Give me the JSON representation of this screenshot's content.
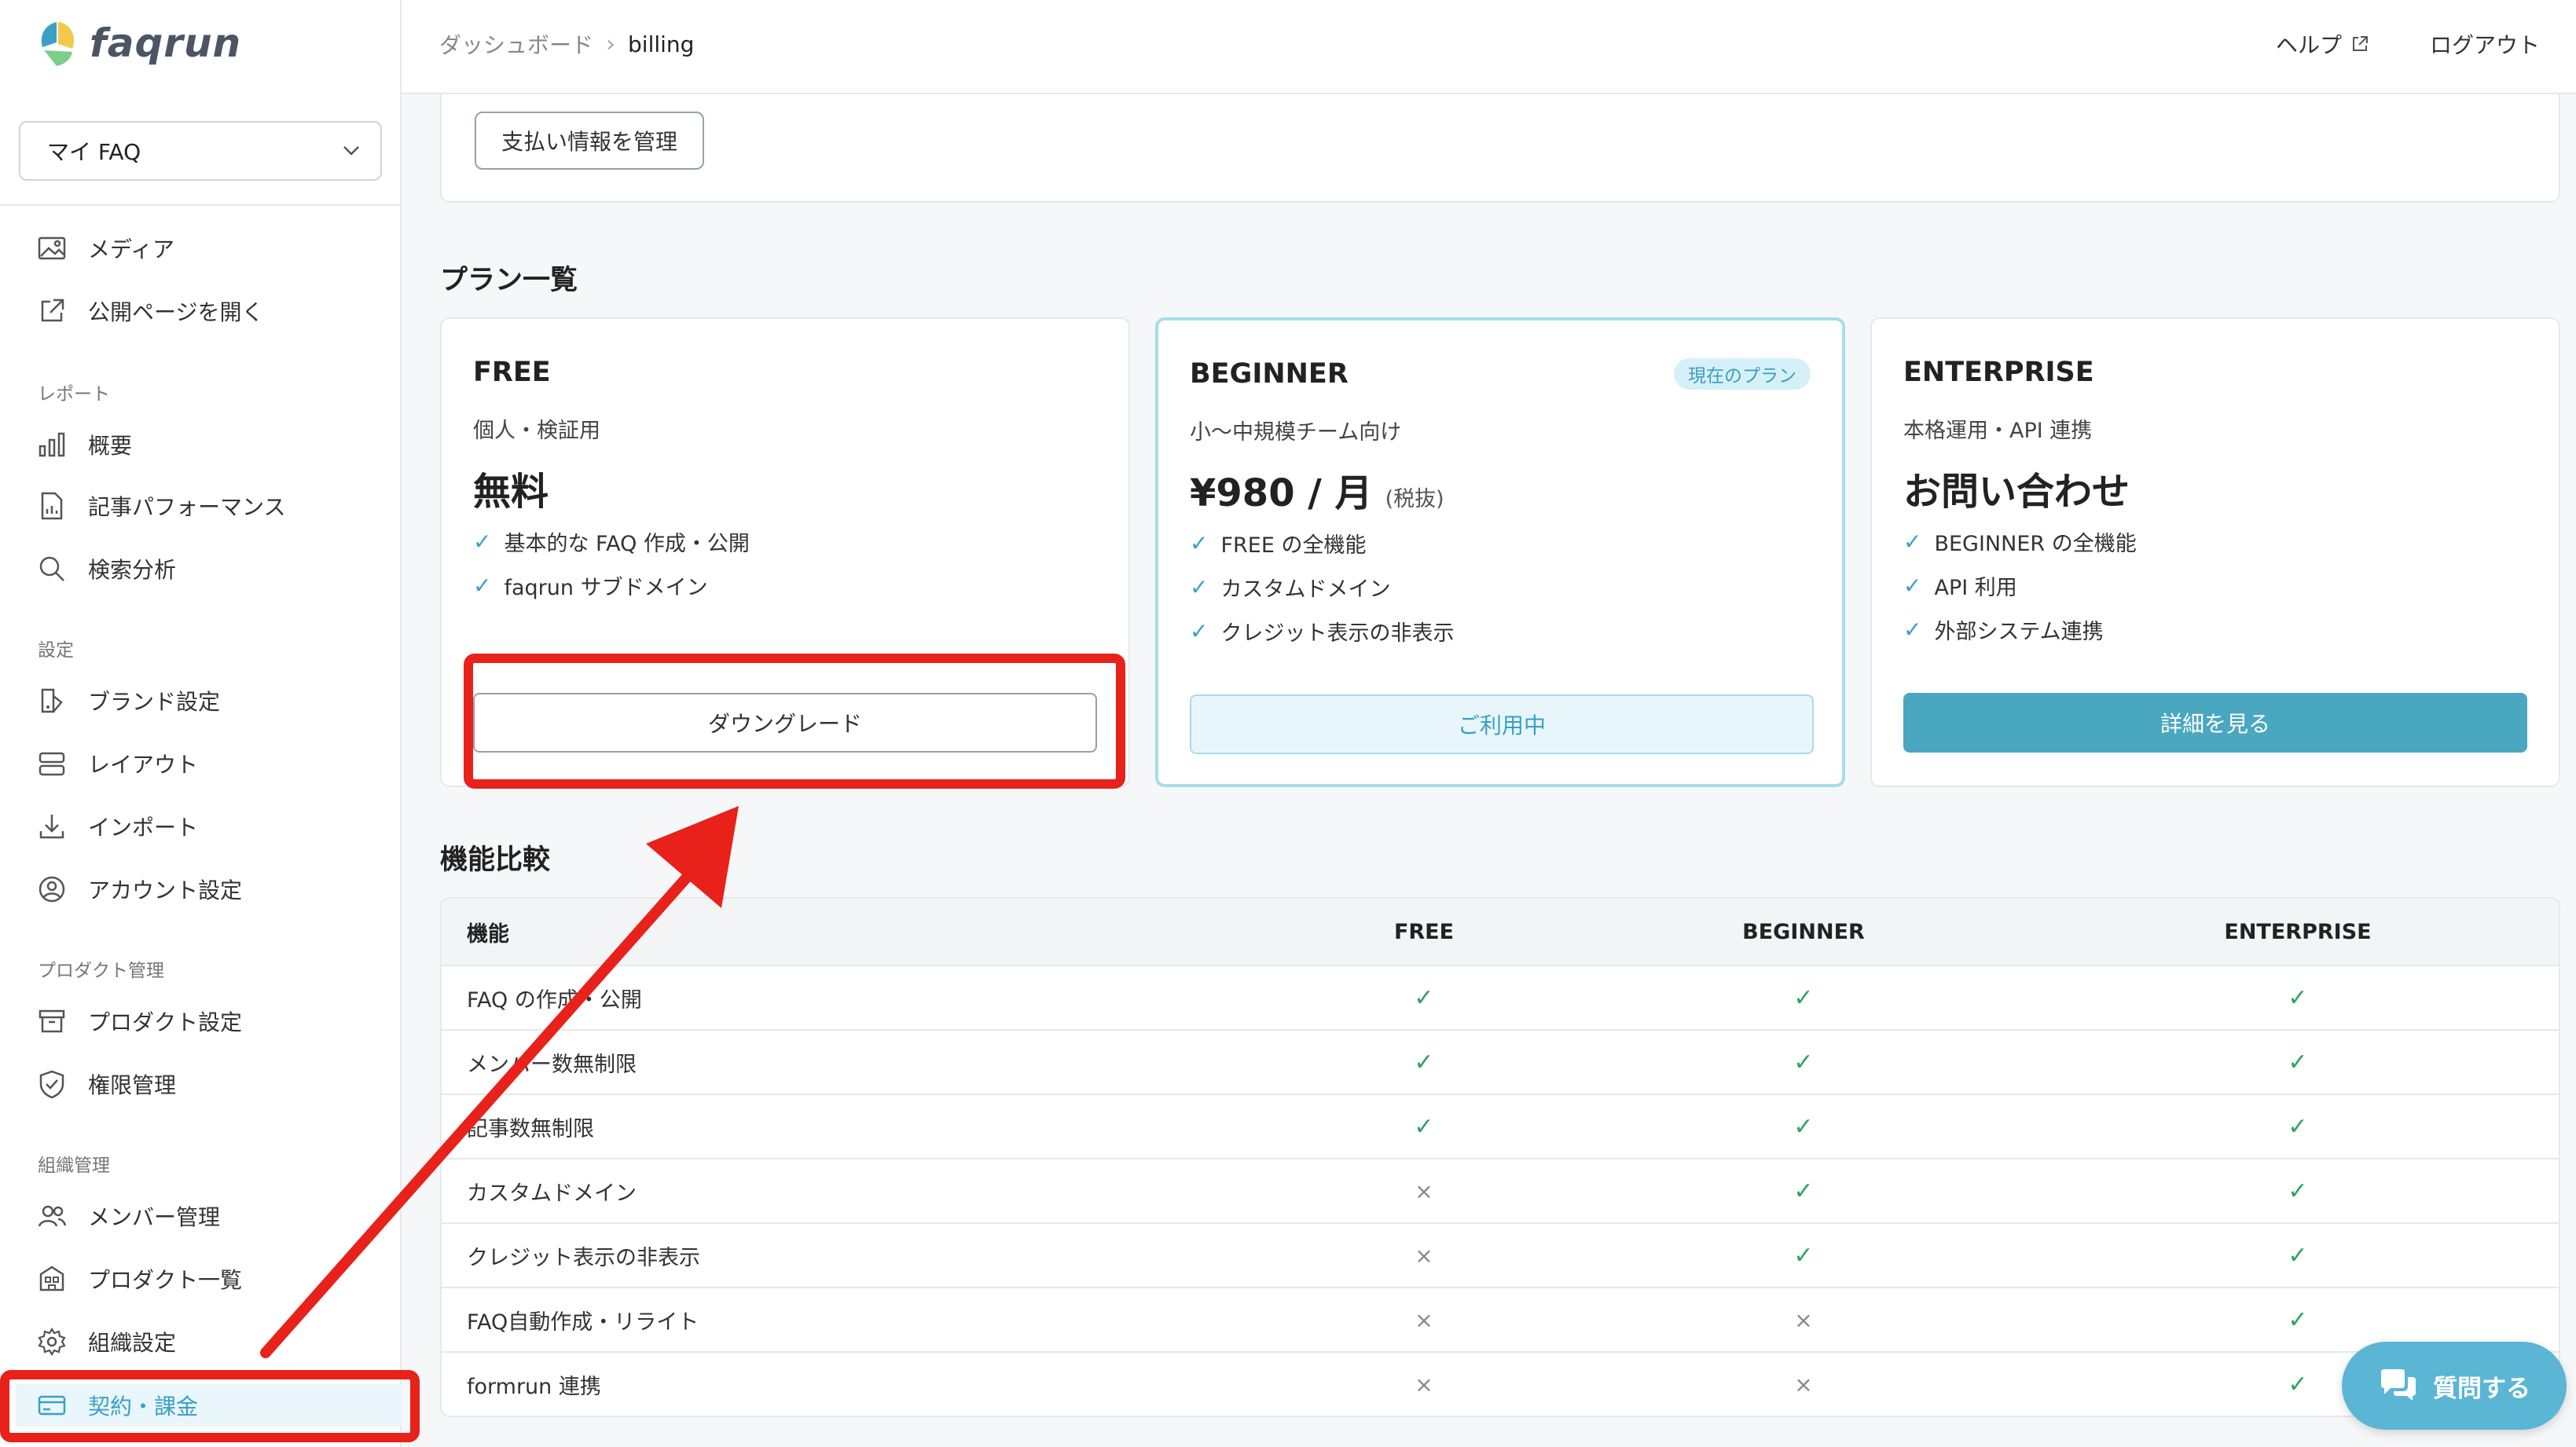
{
  "app": {
    "logo_text": "faqrun",
    "workspace_select": "マイ FAQ"
  },
  "colors": {
    "accent": "#3aa0c4",
    "primary_button": "#4aa7c0",
    "check_green": "#2fa360",
    "annotation_red": "#e8211b"
  },
  "sidebar": {
    "top_items": [
      {
        "label": "メディア",
        "icon": "image-icon"
      },
      {
        "label": "公開ページを開く",
        "icon": "external-link-icon"
      }
    ],
    "sections": [
      {
        "title": "レポート",
        "items": [
          {
            "label": "概要",
            "icon": "bar-chart-icon"
          },
          {
            "label": "記事パフォーマンス",
            "icon": "document-chart-icon"
          },
          {
            "label": "検索分析",
            "icon": "search-icon"
          }
        ]
      },
      {
        "title": "設定",
        "items": [
          {
            "label": "ブランド設定",
            "icon": "brush-icon"
          },
          {
            "label": "レイアウト",
            "icon": "layout-icon"
          },
          {
            "label": "インポート",
            "icon": "download-icon"
          },
          {
            "label": "アカウント設定",
            "icon": "user-circle-icon"
          }
        ]
      },
      {
        "title": "プロダクト管理",
        "items": [
          {
            "label": "プロダクト設定",
            "icon": "archive-icon"
          },
          {
            "label": "権限管理",
            "icon": "shield-check-icon"
          }
        ]
      },
      {
        "title": "組織管理",
        "items": [
          {
            "label": "メンバー管理",
            "icon": "users-icon"
          },
          {
            "label": "プロダクト一覧",
            "icon": "building-icon"
          },
          {
            "label": "組織設定",
            "icon": "gear-icon"
          }
        ]
      }
    ],
    "active_item": {
      "label": "契約・課金",
      "icon": "credit-card-icon"
    }
  },
  "header": {
    "breadcrumb": [
      "ダッシュボード",
      "billing"
    ],
    "help": "ヘルプ",
    "logout": "ログアウト"
  },
  "payment": {
    "manage_button": "支払い情報を管理"
  },
  "plans_title": "プラン一覧",
  "plans": [
    {
      "name": "FREE",
      "subtitle": "個人・検証用",
      "price": "無料",
      "price_note": "",
      "badge": "",
      "features": [
        "基本的な FAQ 作成・公開",
        "faqrun サブドメイン"
      ],
      "button": "ダウングレード"
    },
    {
      "name": "BEGINNER",
      "subtitle": "小〜中規模チーム向け",
      "price": "¥980 / 月",
      "price_note": "(税抜)",
      "badge": "現在のプラン",
      "features": [
        "FREE の全機能",
        "カスタムドメイン",
        "クレジット表示の非表示"
      ],
      "button": "ご利用中"
    },
    {
      "name": "ENTERPRISE",
      "subtitle": "本格運用・API 連携",
      "price": "お問い合わせ",
      "price_note": "",
      "badge": "",
      "features": [
        "BEGINNER の全機能",
        "API 利用",
        "外部システム連携"
      ],
      "button": "詳細を見る"
    }
  ],
  "comparison": {
    "title": "機能比較",
    "headers": [
      "機能",
      "FREE",
      "BEGINNER",
      "ENTERPRISE"
    ],
    "rows": [
      {
        "feature": "FAQ の作成・公開",
        "values": [
          "✓",
          "✓",
          "✓"
        ]
      },
      {
        "feature": "メンバー数無制限",
        "values": [
          "✓",
          "✓",
          "✓"
        ]
      },
      {
        "feature": "記事数無制限",
        "values": [
          "✓",
          "✓",
          "✓"
        ]
      },
      {
        "feature": "カスタムドメイン",
        "values": [
          "×",
          "✓",
          "✓"
        ]
      },
      {
        "feature": "クレジット表示の非表示",
        "values": [
          "×",
          "✓",
          "✓"
        ]
      },
      {
        "feature": "FAQ自動作成・リライト",
        "values": [
          "×",
          "×",
          "✓"
        ]
      },
      {
        "feature": "formrun 連携",
        "values": [
          "×",
          "×",
          "✓"
        ]
      }
    ]
  },
  "chat_button": "質問する"
}
